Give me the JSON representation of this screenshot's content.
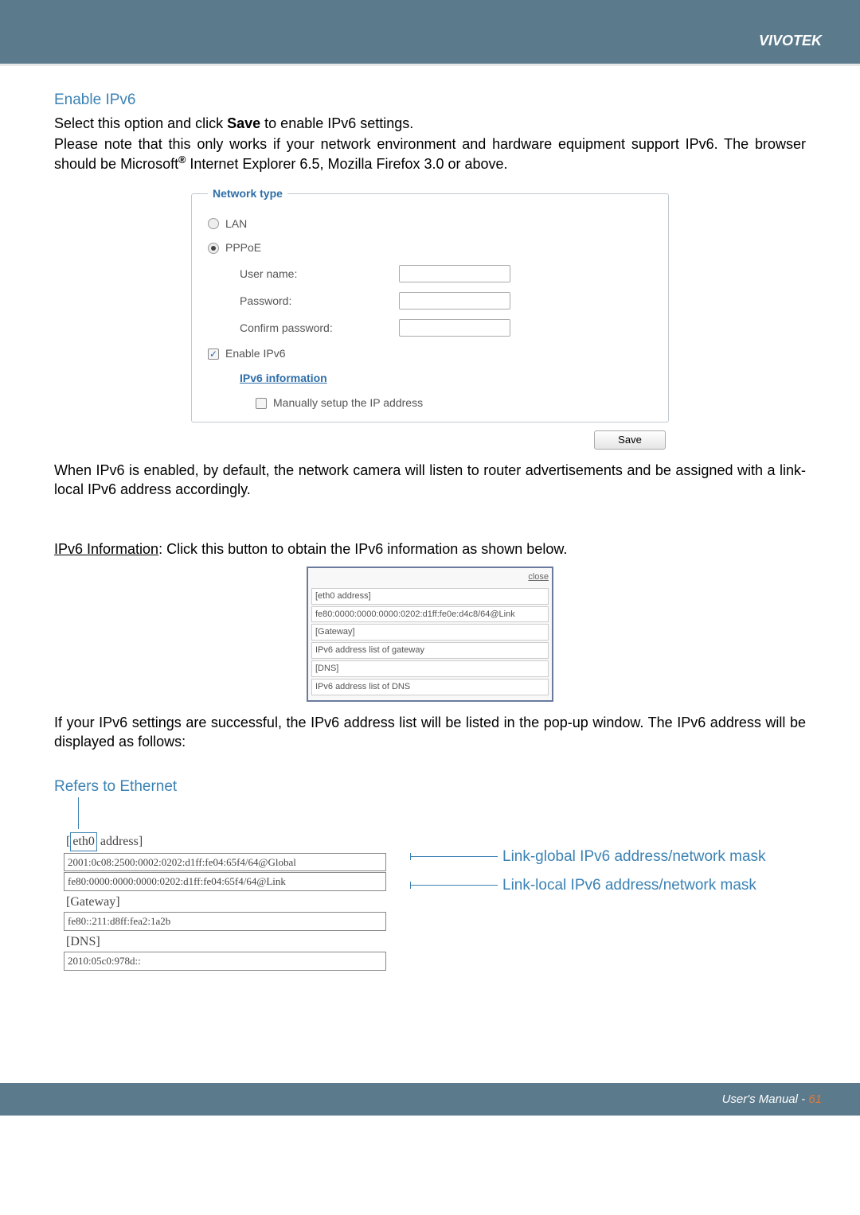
{
  "brand": "VIVOTEK",
  "section": {
    "title": "Enable IPv6",
    "p1a": "Select this option and click ",
    "p1b": "Save",
    "p1c": " to enable IPv6 settings.",
    "p2a": "Please note that this only works if your network environment and hardware equipment support IPv6. The browser should be Microsoft",
    "p2b": " Internet Explorer 6.5, Mozilla Firefox 3.0 or above."
  },
  "form": {
    "legend": "Network type",
    "lan": "LAN",
    "pppoe": "PPPoE",
    "username": "User name:",
    "password": "Password:",
    "confirm": "Confirm password:",
    "enable_ipv6": "Enable IPv6",
    "ipv6_info": "IPv6 information",
    "manual": "Manually setup the IP address",
    "save": "Save"
  },
  "after_form_1": "When IPv6 is enabled, by default, the network camera will listen to router advertisements and be assigned with a link-local IPv6 address accordingly.",
  "ipv6_info_line": {
    "label": "IPv6 Information",
    "rest": ": Click this button to obtain the IPv6 information as shown below."
  },
  "popup": {
    "close": "close",
    "r1": "[eth0 address]",
    "r2": "fe80:0000:0000:0000:0202:d1ff:fe0e:d4c8/64@Link",
    "r3": "[Gateway]",
    "r4": "IPv6 address list of gateway",
    "r5": "[DNS]",
    "r6": "IPv6 address list of DNS"
  },
  "after_popup": "If your IPv6 settings are successful, the IPv6 address list will be listed in the pop-up window. The IPv6 address will be displayed as follows:",
  "refers_title": "Refers to Ethernet",
  "detail": {
    "eth_label": "eth0",
    "addr_label": " address]",
    "addr1": "2001:0c08:2500:0002:0202:d1ff:fe04:65f4/64@Global",
    "addr2": "fe80:0000:0000:0000:0202:d1ff:fe04:65f4/64@Link",
    "gateway_hdr": "[Gateway]",
    "gateway_val": "fe80::211:d8ff:fea2:1a2b",
    "dns_hdr": "[DNS]",
    "dns_val": "2010:05c0:978d::"
  },
  "annot": {
    "global": "Link-global IPv6 address/network mask",
    "local": "Link-local IPv6 address/network mask"
  },
  "footer": {
    "label": "User's Manual - ",
    "page": "61"
  }
}
